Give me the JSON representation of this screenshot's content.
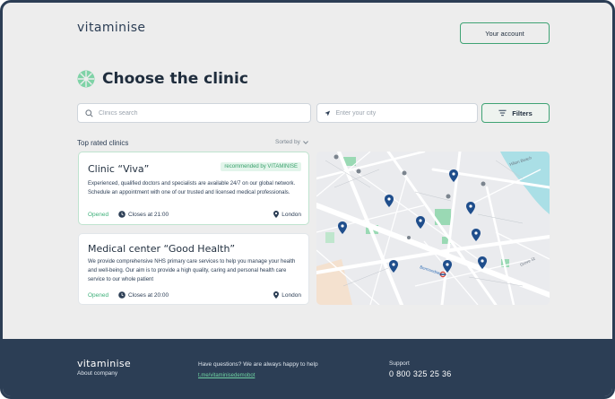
{
  "header": {
    "logo_text": "vitaminise",
    "account_label": "Your account"
  },
  "page": {
    "title": "Choose the clinic"
  },
  "search": {
    "clinic_placeholder": "Clinics search",
    "city_placeholder": "Enter your city",
    "filters_label": "Filters"
  },
  "list": {
    "section_title": "Top rated clinics",
    "sorted_by_label": "Sorted by",
    "clinics": [
      {
        "name": "Clinic “Viva”",
        "badge": "recommended by VITAMINISE",
        "description": "Experienced, qualified doctors and specialists are available 24/7 on our global network. Schedule an appointment with one of our trusted and licensed medical professionals.",
        "status": "Opened",
        "closes": "Closes at 21:00",
        "location": "London"
      },
      {
        "name": "Medical center “Good Health”",
        "description": "We provide comprehensive NHS primary care services to help you manage your health and well-being. Our aim is to provide a high quality, caring and personal health care service to our whole patient",
        "status": "Opened",
        "closes": "Closes at 20:00",
        "location": "London"
      }
    ]
  },
  "map": {
    "labels": [
      "Hilton Beach",
      "Bermondsey",
      "Grove St"
    ],
    "pin_color": "#1f4e8c"
  },
  "footer": {
    "logo_text": "vitaminise",
    "about": "About company",
    "help_text": "Have questions? We are always happy to help",
    "link": "t.me/vitaminisedemobot",
    "support_label": "Support",
    "phone": "0 800 325 25 36"
  },
  "colors": {
    "accent": "#3fa374",
    "navy": "#2c3e55",
    "background": "#ededed"
  }
}
